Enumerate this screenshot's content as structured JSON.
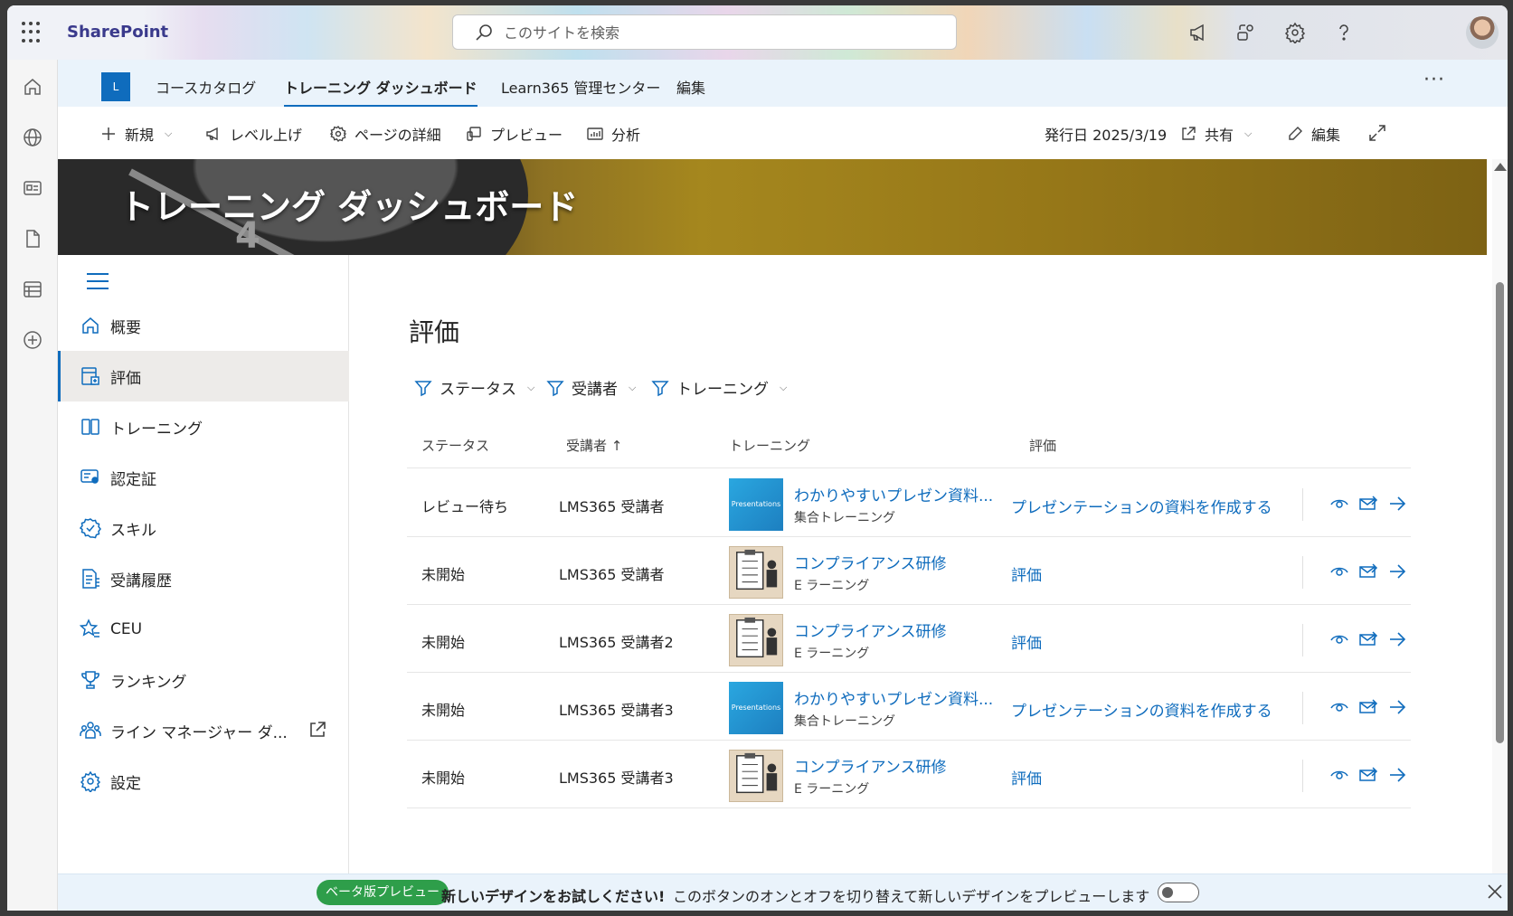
{
  "suite": {
    "brand": "SharePoint",
    "search_placeholder": "このサイトを検索"
  },
  "site_nav": {
    "logo_letter": "L",
    "items": [
      "コースカタログ",
      "トレーニング ダッシュボード",
      "Learn365 管理センター",
      "編集"
    ],
    "active_index": 1,
    "more": "···"
  },
  "command_bar": {
    "new": "新規",
    "level_up": "レベル上げ",
    "page_details": "ページの詳細",
    "preview": "プレビュー",
    "analytics": "分析",
    "published": "発行日 2025/3/19",
    "share": "共有",
    "edit": "編集"
  },
  "banner": {
    "title": "トレーニング ダッシュボード",
    "image_digit": "4"
  },
  "side_menu": {
    "items": [
      {
        "label": "概要",
        "icon": "home-icon"
      },
      {
        "label": "評価",
        "icon": "assessment-icon"
      },
      {
        "label": "トレーニング",
        "icon": "book-icon"
      },
      {
        "label": "認定証",
        "icon": "certificate-icon"
      },
      {
        "label": "スキル",
        "icon": "badge-check-icon"
      },
      {
        "label": "受講履歴",
        "icon": "document-list-icon"
      },
      {
        "label": "CEU",
        "icon": "star-list-icon"
      },
      {
        "label": "ランキング",
        "icon": "trophy-icon"
      },
      {
        "label": "ライン マネージャー ダ...",
        "icon": "people-team-icon"
      },
      {
        "label": "設定",
        "icon": "gear-icon"
      }
    ],
    "selected_index": 1
  },
  "main": {
    "title": "評価",
    "filters": [
      "ステータス",
      "受講者",
      "トレーニング"
    ],
    "columns": {
      "status": "ステータス",
      "learner": "受講者",
      "learner_sort": "↑",
      "training": "トレーニング",
      "assessment": "評価"
    },
    "rows": [
      {
        "status": "レビュー待ち",
        "learner": "LMS365 受講者",
        "training": "わかりやすいプレゼン資料...",
        "type": "集合トレーニング",
        "thumb": "presentation",
        "thumb_text": "Presentations",
        "assessment": "プレゼンテーションの資料を作成する"
      },
      {
        "status": "未開始",
        "learner": "LMS365 受講者",
        "training": "コンプライアンス研修",
        "type": "E ラーニング",
        "thumb": "compliance",
        "thumb_text": "",
        "assessment": "評価"
      },
      {
        "status": "未開始",
        "learner": "LMS365 受講者2",
        "training": "コンプライアンス研修",
        "type": "E ラーニング",
        "thumb": "compliance",
        "thumb_text": "",
        "assessment": "評価"
      },
      {
        "status": "未開始",
        "learner": "LMS365 受講者3",
        "training": "わかりやすいプレゼン資料...",
        "type": "集合トレーニング",
        "thumb": "presentation",
        "thumb_text": "Presentations",
        "assessment": "プレゼンテーションの資料を作成する"
      },
      {
        "status": "未開始",
        "learner": "LMS365 受講者3",
        "training": "コンプライアンス研修",
        "type": "E ラーニング",
        "thumb": "compliance",
        "thumb_text": "",
        "assessment": "評価"
      }
    ]
  },
  "beta_bar": {
    "pill": "ベータ版プレビュー",
    "title": "新しいデザインをお試しください!",
    "description": "このボタンのオンとオフを切り替えて新しいデザインをプレビューします",
    "toggle_on": false
  },
  "colors": {
    "accent": "#0f6cbd",
    "beta_green": "#2e9e4a",
    "brand": "#3a3a8c"
  }
}
